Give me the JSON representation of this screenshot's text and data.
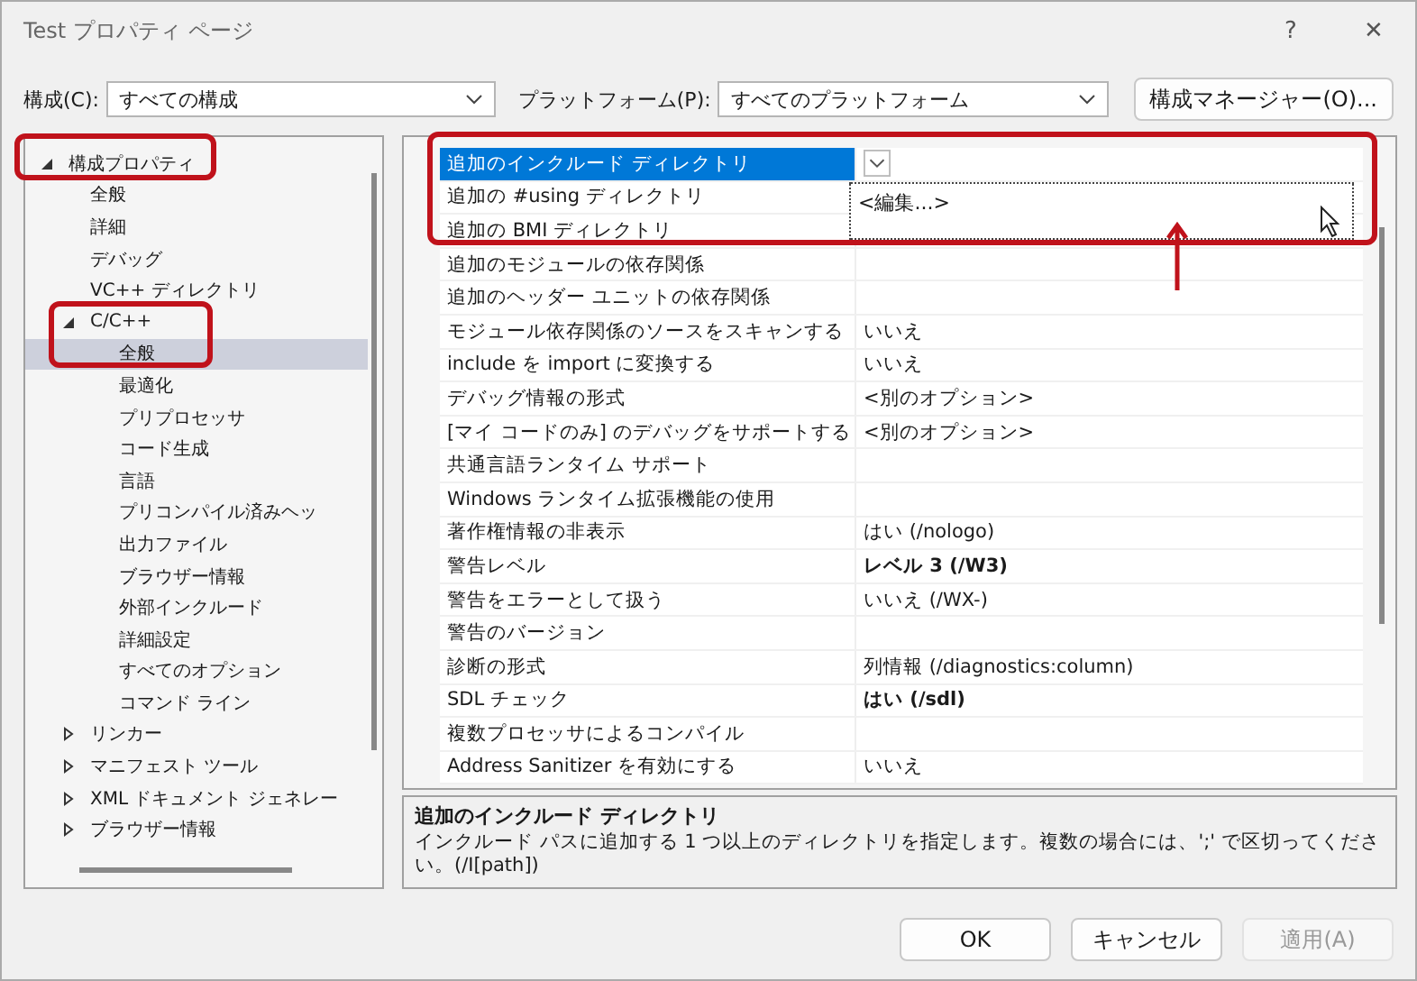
{
  "window": {
    "title": "Test プロパティ ページ",
    "help": "?",
    "close": "✕"
  },
  "toolbar": {
    "config_label": "構成(C):",
    "config_value": "すべての構成",
    "platform_label": "プラットフォーム(P):",
    "platform_value": "すべてのプラットフォーム",
    "manager_button": "構成マネージャー(O)..."
  },
  "tree": [
    {
      "label": "構成プロパティ",
      "expanded": true,
      "selected": false,
      "children": [
        {
          "label": "全般",
          "selected": false
        },
        {
          "label": "詳細",
          "selected": false
        },
        {
          "label": "デバッグ",
          "selected": false
        },
        {
          "label": "VC++ ディレクトリ",
          "selected": false
        },
        {
          "label": "C/C++",
          "expanded": true,
          "selected": false,
          "children": [
            {
              "label": "全般",
              "selected": true
            },
            {
              "label": "最適化",
              "selected": false
            },
            {
              "label": "プリプロセッサ",
              "selected": false
            },
            {
              "label": "コード生成",
              "selected": false
            },
            {
              "label": "言語",
              "selected": false
            },
            {
              "label": "プリコンパイル済みヘッ",
              "selected": false
            },
            {
              "label": "出力ファイル",
              "selected": false
            },
            {
              "label": "ブラウザー情報",
              "selected": false
            },
            {
              "label": "外部インクルード",
              "selected": false
            },
            {
              "label": "詳細設定",
              "selected": false
            },
            {
              "label": "すべてのオプション",
              "selected": false
            },
            {
              "label": "コマンド ライン",
              "selected": false
            }
          ]
        },
        {
          "label": "リンカー",
          "expanded": false,
          "selected": false
        },
        {
          "label": "マニフェスト ツール",
          "expanded": false,
          "selected": false
        },
        {
          "label": "XML ドキュメント ジェネレー",
          "expanded": false,
          "selected": false
        },
        {
          "label": "ブラウザー情報",
          "expanded": false,
          "selected": false
        }
      ]
    }
  ],
  "grid": {
    "rows": [
      {
        "name": "追加のインクルード ディレクトリ",
        "value": "",
        "selected": true
      },
      {
        "name": "追加の #using ディレクトリ",
        "value": "",
        "selected": false
      },
      {
        "name": "追加の BMI ディレクトリ",
        "value": "",
        "selected": false
      },
      {
        "name": "追加のモジュールの依存関係",
        "value": "",
        "selected": false
      },
      {
        "name": "追加のヘッダー ユニットの依存関係",
        "value": "",
        "selected": false
      },
      {
        "name": "モジュール依存関係のソースをスキャンする",
        "value": "いいえ",
        "selected": false,
        "bold": false
      },
      {
        "name": "include を import に変換する",
        "value": "いいえ",
        "selected": false,
        "bold": false
      },
      {
        "name": "デバッグ情報の形式",
        "value": "<別のオプション>",
        "selected": false,
        "bold": false
      },
      {
        "name": "[マイ コードのみ] のデバッグをサポートする",
        "value": "<別のオプション>",
        "selected": false,
        "bold": false
      },
      {
        "name": "共通言語ランタイム サポート",
        "value": "",
        "selected": false
      },
      {
        "name": "Windows ランタイム拡張機能の使用",
        "value": "",
        "selected": false
      },
      {
        "name": "著作権情報の非表示",
        "value": "はい (/nologo)",
        "selected": false,
        "bold": false
      },
      {
        "name": "警告レベル",
        "value": "レベル 3 (/W3)",
        "selected": false,
        "bold": true
      },
      {
        "name": "警告をエラーとして扱う",
        "value": "いいえ (/WX-)",
        "selected": false,
        "bold": false
      },
      {
        "name": "警告のバージョン",
        "value": "",
        "selected": false
      },
      {
        "name": "診断の形式",
        "value": "列情報 (/diagnostics:column)",
        "selected": false,
        "bold": false
      },
      {
        "name": "SDL チェック",
        "value": "はい (/sdl)",
        "selected": false,
        "bold": true
      },
      {
        "name": "複数プロセッサによるコンパイル",
        "value": "",
        "selected": false
      },
      {
        "name": "Address Sanitizer を有効にする",
        "value": "いいえ",
        "selected": false,
        "bold": false
      }
    ],
    "dropdown_option": "<編集...>"
  },
  "description": {
    "title": "追加のインクルード ディレクトリ",
    "text": "インクルード パスに追加する 1 つ以上のディレクトリを指定します。複数の場合には、';' で区切ってください。(/I[path])"
  },
  "buttons": [
    {
      "label": "OK",
      "disabled": false
    },
    {
      "label": "キャンセル",
      "disabled": false
    },
    {
      "label": "適用(A)",
      "disabled": true
    }
  ]
}
